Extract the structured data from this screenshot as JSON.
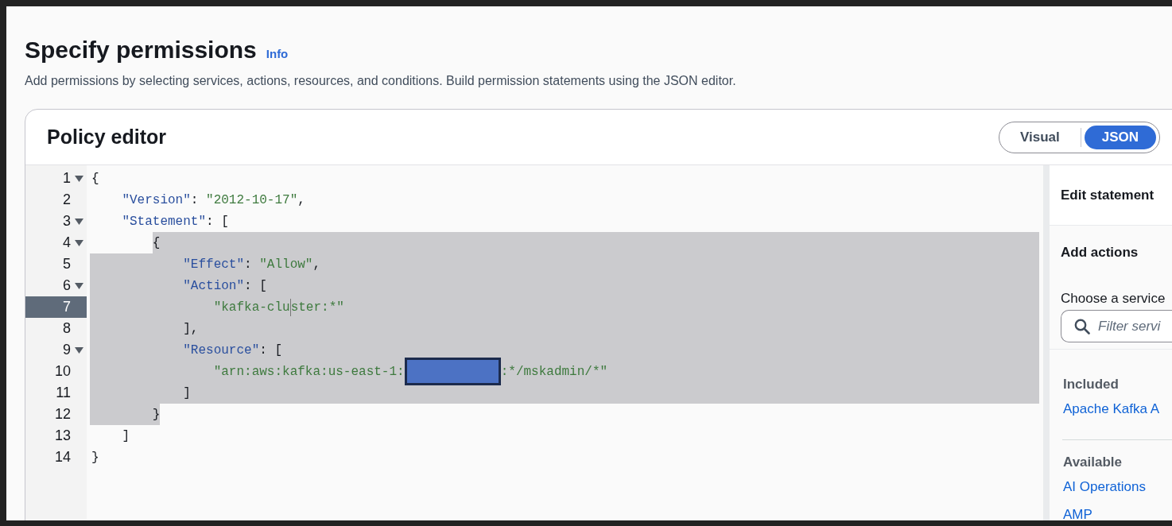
{
  "header": {
    "title": "Specify permissions",
    "info_link": "Info",
    "description": "Add permissions by selecting services, actions, resources, and conditions. Build permission statements using the JSON editor."
  },
  "policy_editor": {
    "title": "Policy editor",
    "modes": [
      {
        "label": "Visual",
        "selected": false
      },
      {
        "label": "JSON",
        "selected": true
      }
    ],
    "lines": [
      {
        "number": "1",
        "foldable": true,
        "active": false,
        "selected": false,
        "tokens": [
          {
            "kind": "punct",
            "text": "{"
          }
        ]
      },
      {
        "number": "2",
        "foldable": false,
        "active": false,
        "selected": false,
        "tokens": [
          {
            "kind": "key",
            "text": "    \"Version\""
          },
          {
            "kind": "punct",
            "text": ": "
          },
          {
            "kind": "string",
            "text": "\"2012-10-17\""
          },
          {
            "kind": "punct",
            "text": ","
          }
        ]
      },
      {
        "number": "3",
        "foldable": true,
        "active": false,
        "selected": false,
        "tokens": [
          {
            "kind": "key",
            "text": "    \"Statement\""
          },
          {
            "kind": "punct",
            "text": ": ["
          }
        ]
      },
      {
        "number": "4",
        "foldable": true,
        "active": false,
        "selected": true,
        "starts_selection": true,
        "ends_selection": false,
        "tokens": [
          {
            "kind": "punct",
            "text": "        {"
          }
        ]
      },
      {
        "number": "5",
        "foldable": false,
        "active": false,
        "selected": true,
        "starts_selection": false,
        "ends_selection": false,
        "tokens": [
          {
            "kind": "key",
            "text": "            \"Effect\""
          },
          {
            "kind": "punct",
            "text": ": "
          },
          {
            "kind": "string",
            "text": "\"Allow\""
          },
          {
            "kind": "punct",
            "text": ","
          }
        ]
      },
      {
        "number": "6",
        "foldable": true,
        "active": false,
        "selected": true,
        "starts_selection": false,
        "ends_selection": false,
        "tokens": [
          {
            "kind": "key",
            "text": "            \"Action\""
          },
          {
            "kind": "punct",
            "text": ": ["
          }
        ]
      },
      {
        "number": "7",
        "foldable": false,
        "active": true,
        "selected": true,
        "starts_selection": false,
        "ends_selection": false,
        "tokens": [
          {
            "kind": "string",
            "text": "                \"kafka-clu"
          },
          {
            "kind": "cursor"
          },
          {
            "kind": "string",
            "text": "ster:*\""
          }
        ]
      },
      {
        "number": "8",
        "foldable": false,
        "active": false,
        "selected": true,
        "starts_selection": false,
        "ends_selection": false,
        "tokens": [
          {
            "kind": "punct",
            "text": "            ],"
          }
        ]
      },
      {
        "number": "9",
        "foldable": true,
        "active": false,
        "selected": true,
        "starts_selection": false,
        "ends_selection": false,
        "tokens": [
          {
            "kind": "key",
            "text": "            \"Resource\""
          },
          {
            "kind": "punct",
            "text": ": ["
          }
        ]
      },
      {
        "number": "10",
        "foldable": false,
        "active": false,
        "selected": true,
        "starts_selection": false,
        "ends_selection": false,
        "tokens": [
          {
            "kind": "string",
            "text": "                \"arn:aws:kafka:us-east-1:"
          },
          {
            "kind": "redacted"
          },
          {
            "kind": "string",
            "text": ":*/mskadmin/*\""
          }
        ]
      },
      {
        "number": "11",
        "foldable": false,
        "active": false,
        "selected": true,
        "starts_selection": false,
        "ends_selection": false,
        "tokens": [
          {
            "kind": "punct",
            "text": "            ]"
          }
        ]
      },
      {
        "number": "12",
        "foldable": false,
        "active": false,
        "selected": true,
        "starts_selection": false,
        "ends_selection": true,
        "tokens": [
          {
            "kind": "punct",
            "text": "        }"
          }
        ]
      },
      {
        "number": "13",
        "foldable": false,
        "active": false,
        "selected": false,
        "tokens": [
          {
            "kind": "punct",
            "text": "    ]"
          }
        ]
      },
      {
        "number": "14",
        "foldable": false,
        "active": false,
        "selected": false,
        "tokens": [
          {
            "kind": "punct",
            "text": "}"
          }
        ]
      }
    ],
    "side_panel": {
      "title": "Edit statement",
      "section_title": "Add actions",
      "service_label": "Choose a service",
      "search": {
        "placeholder": "Filter servi"
      },
      "groups": [
        {
          "heading": "Included",
          "items": [
            "Apache Kafka A"
          ]
        },
        {
          "heading": "Available",
          "items": [
            "AI Operations",
            "AMP"
          ]
        }
      ]
    }
  }
}
